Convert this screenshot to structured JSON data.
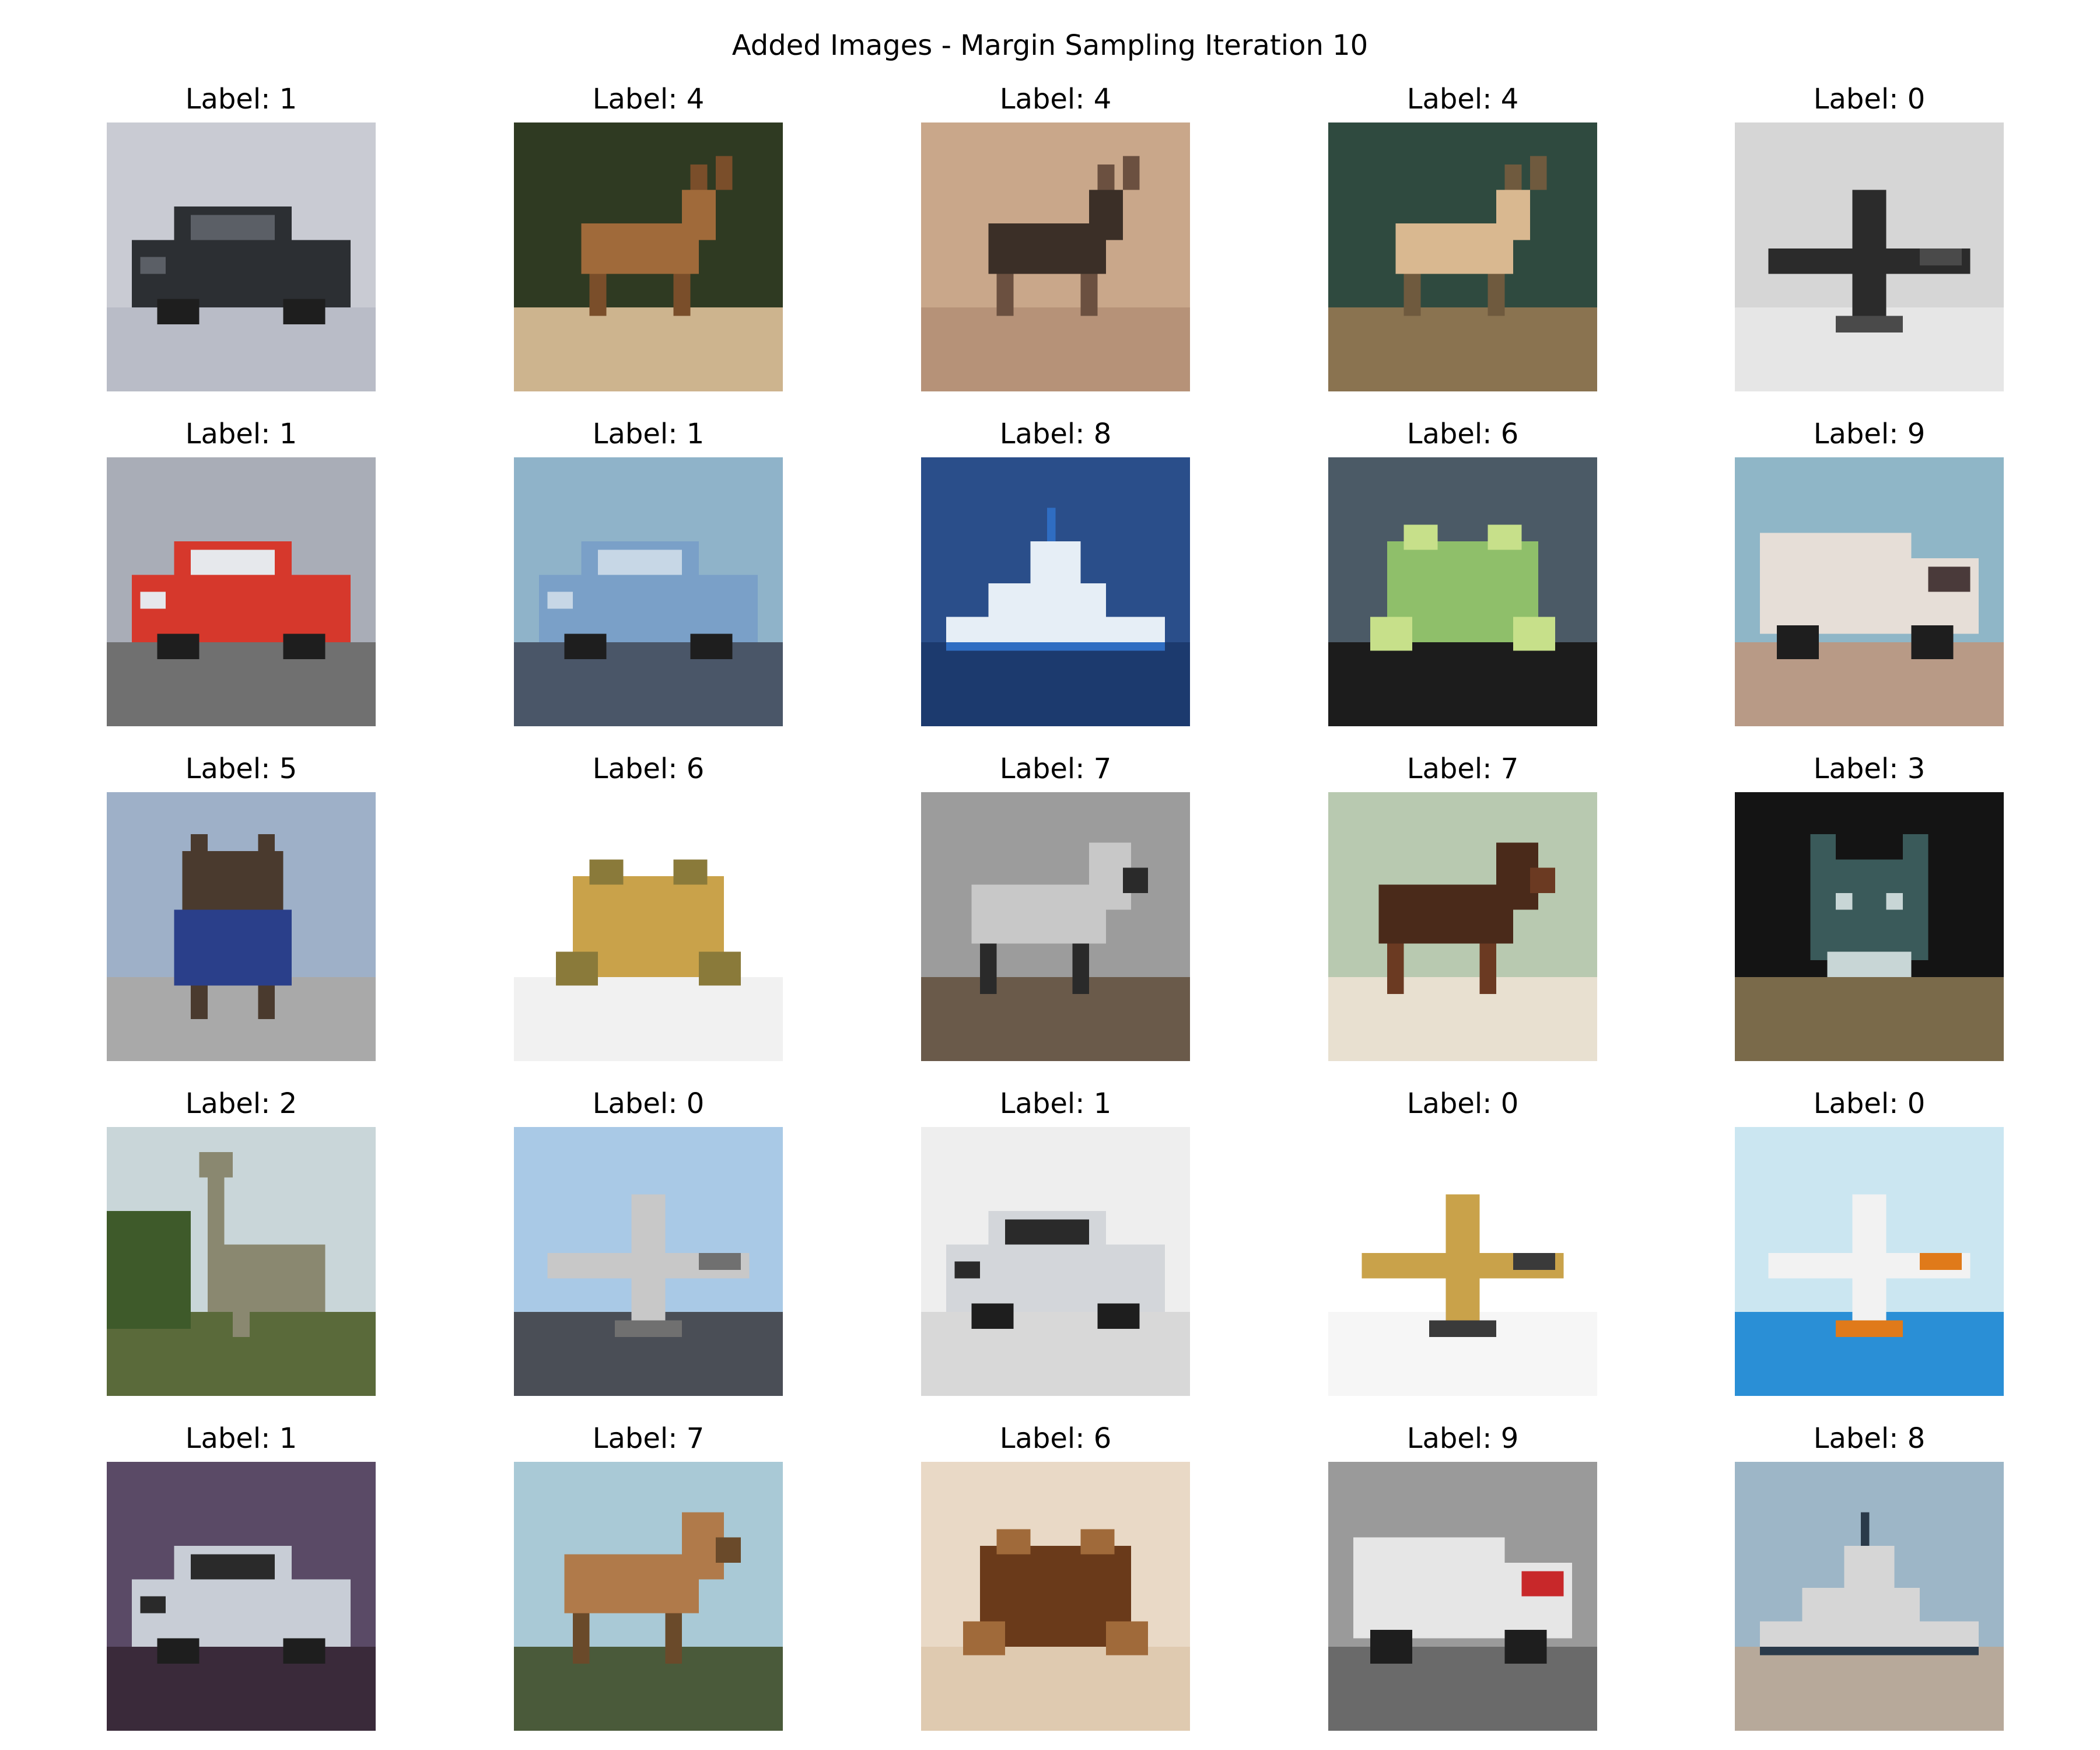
{
  "title": "Added Images - Margin Sampling Iteration 10",
  "grid": [
    {
      "label": "Label: 1",
      "subject": "car",
      "colors": {
        "bg": "#c9cbd3",
        "ground": "#b9bcc7",
        "main": "#2c2f33",
        "accent": "#5b5f66"
      }
    },
    {
      "label": "Label: 4",
      "subject": "deer",
      "colors": {
        "bg": "#2f3a22",
        "ground": "#cdb48e",
        "main": "#a06a3a",
        "accent": "#7a4e2a"
      }
    },
    {
      "label": "Label: 4",
      "subject": "deer",
      "colors": {
        "bg": "#c9a78a",
        "ground": "#b69278",
        "main": "#3b2f27",
        "accent": "#6b5040"
      }
    },
    {
      "label": "Label: 4",
      "subject": "deer",
      "colors": {
        "bg": "#2f4a3f",
        "ground": "#8a7350",
        "main": "#d9b890",
        "accent": "#6f5a3e"
      }
    },
    {
      "label": "Label: 0",
      "subject": "airplane",
      "colors": {
        "bg": "#d6d6d6",
        "ground": "#e6e6e6",
        "main": "#2b2b2b",
        "accent": "#4a4a4a"
      }
    },
    {
      "label": "Label: 1",
      "subject": "car",
      "colors": {
        "bg": "#a9adb7",
        "ground": "#707070",
        "main": "#d6382c",
        "accent": "#e6e8ec"
      }
    },
    {
      "label": "Label: 1",
      "subject": "car",
      "colors": {
        "bg": "#8fb3c9",
        "ground": "#4a5668",
        "main": "#7aa0c8",
        "accent": "#c7d7e6"
      }
    },
    {
      "label": "Label: 8",
      "subject": "ship",
      "colors": {
        "bg": "#2a4e8a",
        "ground": "#1c3a6e",
        "main": "#e6eef6",
        "accent": "#2f6dc2"
      }
    },
    {
      "label": "Label: 6",
      "subject": "frog",
      "colors": {
        "bg": "#4b5a66",
        "ground": "#1c1c1c",
        "main": "#8fbf6a",
        "accent": "#c7e08a"
      }
    },
    {
      "label": "Label: 9",
      "subject": "truck",
      "colors": {
        "bg": "#8fb6c7",
        "ground": "#b89a86",
        "main": "#e6ded7",
        "accent": "#4a3a3a"
      }
    },
    {
      "label": "Label: 5",
      "subject": "dog",
      "colors": {
        "bg": "#9eb0c8",
        "ground": "#a9a9a9",
        "main": "#4a3a2e",
        "accent": "#2a3f8a"
      }
    },
    {
      "label": "Label: 6",
      "subject": "frog",
      "colors": {
        "bg": "#ffffff",
        "ground": "#f1f1f1",
        "main": "#c9a24a",
        "accent": "#8a7a3a"
      }
    },
    {
      "label": "Label: 7",
      "subject": "horse",
      "colors": {
        "bg": "#9c9c9c",
        "ground": "#6a5a4a",
        "main": "#c8c8c8",
        "accent": "#2a2a2a"
      }
    },
    {
      "label": "Label: 7",
      "subject": "horse",
      "colors": {
        "bg": "#b8c9b0",
        "ground": "#e8e0d0",
        "main": "#4a2a1a",
        "accent": "#6b3a22"
      }
    },
    {
      "label": "Label: 3",
      "subject": "cat",
      "colors": {
        "bg": "#141414",
        "ground": "#7a6a4a",
        "main": "#3a5a5a",
        "accent": "#c8d6d6"
      }
    },
    {
      "label": "Label: 2",
      "subject": "bird",
      "colors": {
        "bg": "#c9d6d9",
        "ground": "#5a6a3a",
        "main": "#8a8870",
        "accent": "#3e5a2a"
      }
    },
    {
      "label": "Label: 0",
      "subject": "airplane",
      "colors": {
        "bg": "#a9c9e6",
        "ground": "#4a4e56",
        "main": "#c8c8c8",
        "accent": "#707070"
      }
    },
    {
      "label": "Label: 1",
      "subject": "car",
      "colors": {
        "bg": "#eeeeee",
        "ground": "#d8d8d8",
        "main": "#d3d6da",
        "accent": "#2a2a2a"
      }
    },
    {
      "label": "Label: 0",
      "subject": "airplane",
      "colors": {
        "bg": "#ffffff",
        "ground": "#f6f6f6",
        "main": "#c9a24a",
        "accent": "#3a3a3a"
      }
    },
    {
      "label": "Label: 0",
      "subject": "airplane",
      "colors": {
        "bg": "#cbe6f1",
        "ground": "#2a8fd6",
        "main": "#f2f2f2",
        "accent": "#e07a1a"
      }
    },
    {
      "label": "Label: 1",
      "subject": "car",
      "colors": {
        "bg": "#5a4a66",
        "ground": "#3a2a3a",
        "main": "#c8cdd6",
        "accent": "#2a2a2a"
      }
    },
    {
      "label": "Label: 7",
      "subject": "horse",
      "colors": {
        "bg": "#a9c9d6",
        "ground": "#4a5a3a",
        "main": "#b07a4a",
        "accent": "#6a4a2a"
      }
    },
    {
      "label": "Label: 6",
      "subject": "frog",
      "colors": {
        "bg": "#e9d9c6",
        "ground": "#dfcab0",
        "main": "#6a3a1a",
        "accent": "#a06a3a"
      }
    },
    {
      "label": "Label: 9",
      "subject": "truck",
      "colors": {
        "bg": "#9a9a9a",
        "ground": "#6a6a6a",
        "main": "#e6e6e6",
        "accent": "#c8282a"
      }
    },
    {
      "label": "Label: 8",
      "subject": "ship",
      "colors": {
        "bg": "#9db6c7",
        "ground": "#b7a99a",
        "main": "#d6d6d6",
        "accent": "#2a3a4a"
      }
    }
  ]
}
